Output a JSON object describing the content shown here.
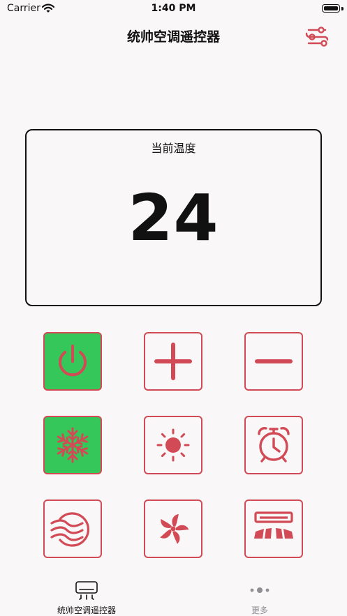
{
  "status_bar": {
    "carrier": "Carrier",
    "time": "1:40 PM"
  },
  "nav": {
    "title": "统帅空调遥控器",
    "settings_icon": "sliders-icon"
  },
  "temperature": {
    "label": "当前温度",
    "value": "24"
  },
  "controls": [
    {
      "id": "power",
      "icon": "power-icon",
      "active": true
    },
    {
      "id": "temp-up",
      "icon": "plus-icon",
      "active": false
    },
    {
      "id": "temp-down",
      "icon": "minus-icon",
      "active": false
    },
    {
      "id": "cool",
      "icon": "snowflake-icon",
      "active": true
    },
    {
      "id": "heat",
      "icon": "sun-icon",
      "active": false
    },
    {
      "id": "timer",
      "icon": "alarm-clock-icon",
      "active": false
    },
    {
      "id": "dry",
      "icon": "wind-icon",
      "active": false
    },
    {
      "id": "fan",
      "icon": "fan-icon",
      "active": false
    },
    {
      "id": "swing",
      "icon": "air-conditioner-swing-icon",
      "active": false
    }
  ],
  "tabs": [
    {
      "label": "统帅空调遥控器",
      "icon": "air-conditioner-icon",
      "selected": true
    },
    {
      "label": "更多",
      "icon": "more-dots-icon",
      "selected": false
    }
  ],
  "colors": {
    "accent": "#D14A55",
    "active": "#35C759",
    "background": "#F9F7F8",
    "text": "#111111",
    "tab_inactive": "#8E8E93"
  }
}
